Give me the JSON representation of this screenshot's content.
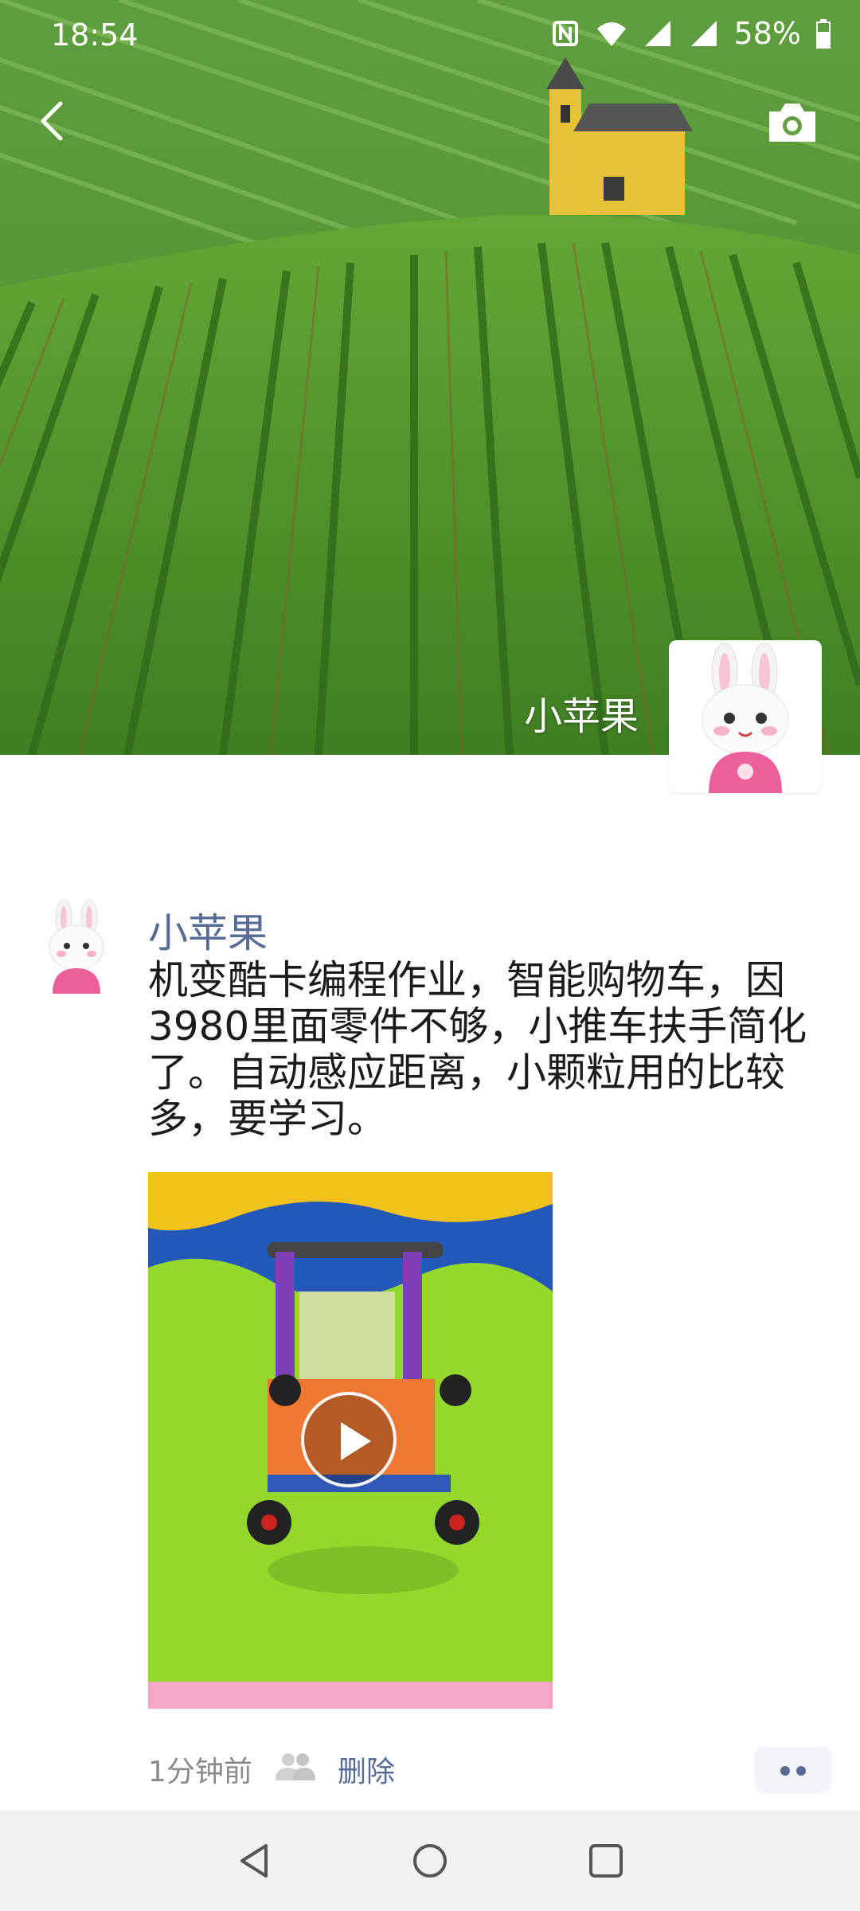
{
  "status_bar": {
    "time": "18:54",
    "battery": "58%",
    "icons": [
      "nfc-icon",
      "wifi-icon",
      "signal-icon",
      "signal-icon",
      "battery-icon"
    ]
  },
  "header": {
    "back_icon": "back-chevron-icon",
    "camera_icon": "camera-icon"
  },
  "profile": {
    "name": "小苹果"
  },
  "post": {
    "author": "小苹果",
    "text": "机变酷卡编程作业，智能购物车，因3980里面零件不够，小推车扶手简化了。自动感应距离，小颗粒用的比较多，要学习。",
    "media_type": "video",
    "time_ago": "1分钟前",
    "delete_label": "删除",
    "visibility_icon": "friends-icon",
    "more_icon": "more-dots-icon"
  },
  "nav": {
    "buttons": [
      "back-triangle-icon",
      "home-circle-icon",
      "recents-square-icon"
    ]
  },
  "colors": {
    "link": "#576b95",
    "meta": "#8a8a8a",
    "text": "#1b1b1b"
  }
}
